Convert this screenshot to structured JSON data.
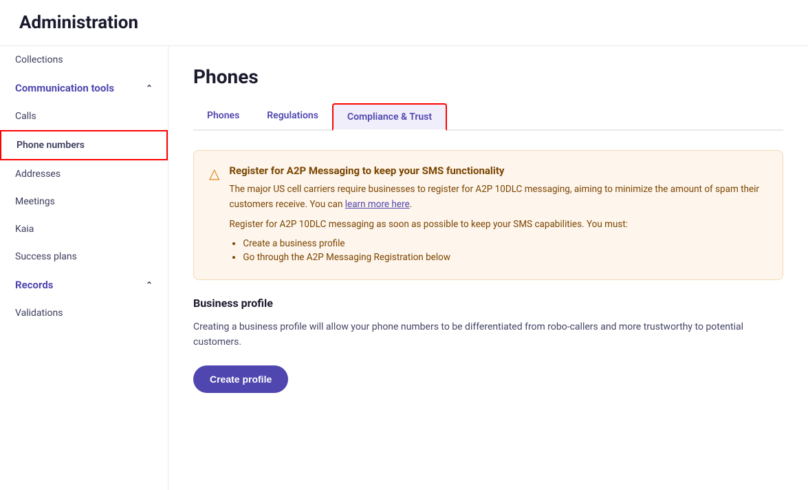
{
  "header": {
    "title": "Administration"
  },
  "sidebar": {
    "items": [
      {
        "id": "collections",
        "label": "Collections",
        "type": "item"
      },
      {
        "id": "communication-tools",
        "label": "Communication tools",
        "type": "section-header",
        "expanded": true
      },
      {
        "id": "calls",
        "label": "Calls",
        "type": "sub-item"
      },
      {
        "id": "phone-numbers",
        "label": "Phone numbers",
        "type": "sub-item",
        "selected": true
      },
      {
        "id": "addresses",
        "label": "Addresses",
        "type": "sub-item"
      },
      {
        "id": "meetings",
        "label": "Meetings",
        "type": "sub-item"
      },
      {
        "id": "kaia",
        "label": "Kaia",
        "type": "sub-item"
      },
      {
        "id": "success-plans",
        "label": "Success plans",
        "type": "item"
      },
      {
        "id": "records",
        "label": "Records",
        "type": "section-header",
        "expanded": true
      },
      {
        "id": "validations",
        "label": "Validations",
        "type": "sub-item"
      }
    ]
  },
  "main": {
    "page_title": "Phones",
    "tabs": [
      {
        "id": "phones",
        "label": "Phones",
        "active": false
      },
      {
        "id": "regulations",
        "label": "Regulations",
        "active": false
      },
      {
        "id": "compliance-trust",
        "label": "Compliance & Trust",
        "active": true
      }
    ],
    "alert": {
      "title": "Register for A2P Messaging to keep your SMS functionality",
      "paragraph1": "The major US cell carriers require businesses to register for A2P 10DLC messaging, aiming to minimize the amount of spam their customers receive. You can learn more here.",
      "paragraph2": "Register for A2P 10DLC messaging as soon as possible to keep your SMS capabilities. You must:",
      "list_items": [
        "Create a business profile",
        "Go through the A2P Messaging Registration below"
      ]
    },
    "business_profile": {
      "section_title": "Business profile",
      "description": "Creating a business profile will allow your phone numbers to be differentiated from robo-callers and more trustworthy to potential customers.",
      "create_button_label": "Create profile"
    }
  }
}
